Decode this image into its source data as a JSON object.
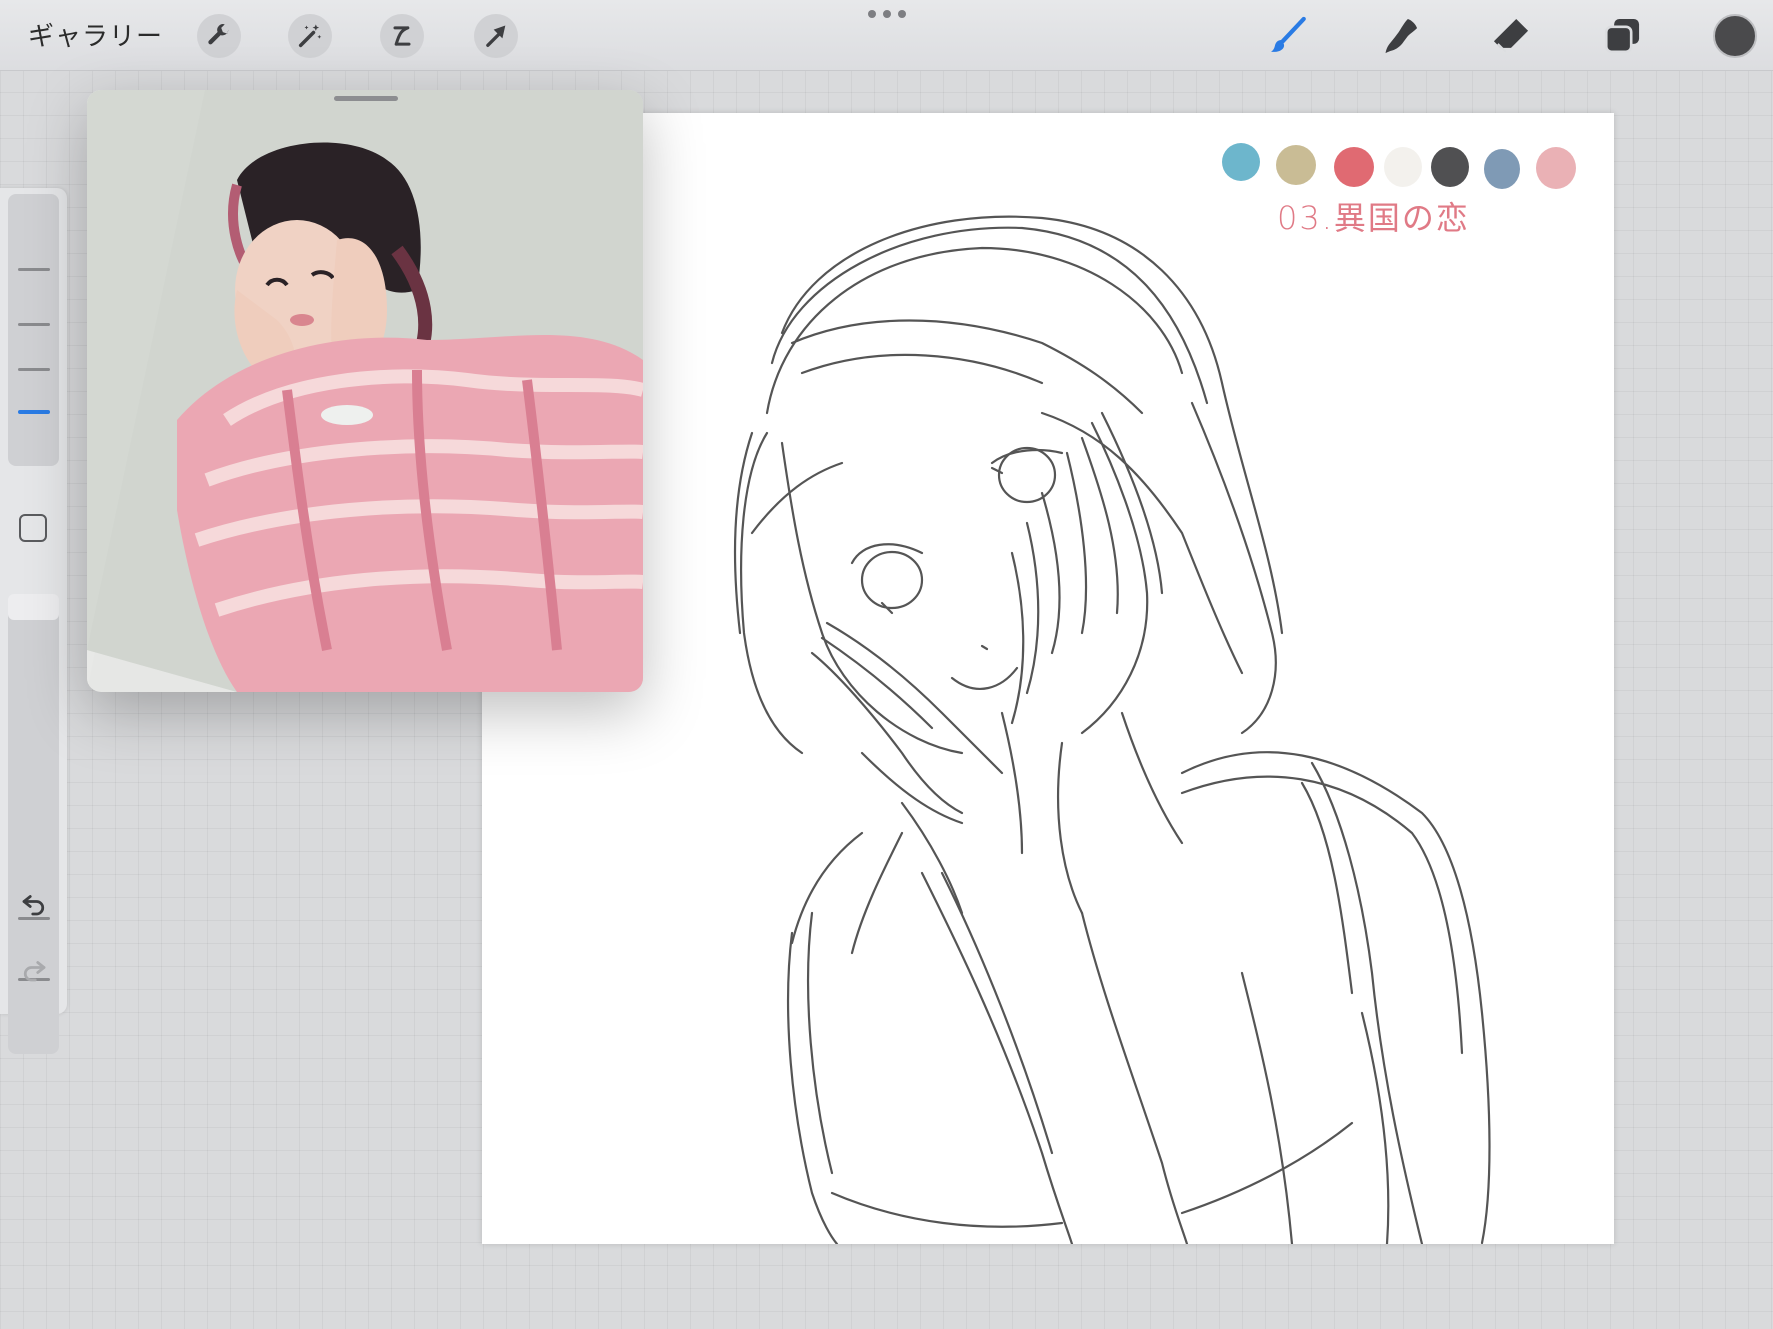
{
  "toolbar": {
    "gallery_label": "ギャラリー",
    "left_tools": [
      "wrench-icon",
      "magic-wand-icon",
      "selection-icon",
      "transform-arrow-icon"
    ],
    "right_tools": [
      "brush-icon",
      "smudge-icon",
      "eraser-icon",
      "layers-icon"
    ],
    "active_tool": "brush-icon",
    "current_color": "#4a4a4c",
    "accent_color": "#2a7be4"
  },
  "sidebar": {
    "brush_size_selected_index": 3,
    "buttons": [
      "modify-square-icon",
      "undo-icon",
      "redo-icon"
    ]
  },
  "canvas": {
    "swatches": [
      "#6db6cc",
      "#c9bc95",
      "#e06a72",
      "#f3f1ed",
      "#505052",
      "#7f9ab5",
      "#eab1b5"
    ],
    "annotation": "03.異国の恋"
  },
  "reference_window": {
    "content": "reference-photo"
  }
}
